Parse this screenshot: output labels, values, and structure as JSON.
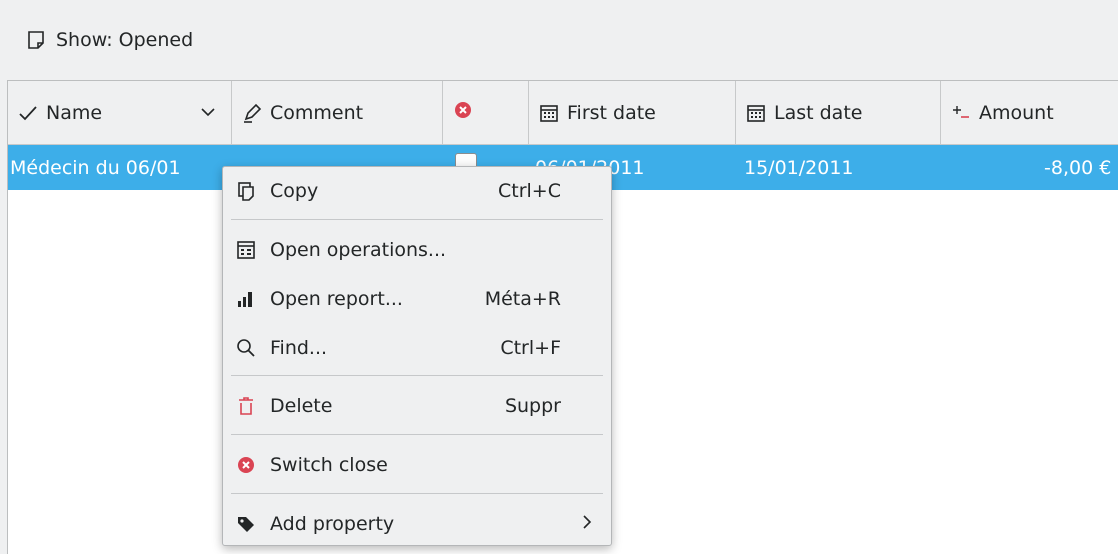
{
  "filter": {
    "label": "Show: Opened",
    "icon": "note-icon"
  },
  "columns": [
    {
      "label": "Name",
      "icon": "checkmark-icon"
    },
    {
      "label": "Comment",
      "icon": "pencil-icon"
    },
    {
      "label": "",
      "icon": "closed-status-icon"
    },
    {
      "label": "First date",
      "icon": "calendar-icon"
    },
    {
      "label": "Last date",
      "icon": "calendar-icon"
    },
    {
      "label": "Amount",
      "icon": "plus-minus-icon"
    }
  ],
  "rows": [
    {
      "name": "Médecin du 06/01",
      "first_date": "06/01/2011",
      "last_date": "15/01/2011",
      "amount": "-8,00 €"
    }
  ],
  "menu": {
    "copy": {
      "label": "Copy",
      "shortcut": "Ctrl+C"
    },
    "open_operations": {
      "label": "Open operations..."
    },
    "open_report": {
      "label": "Open report...",
      "shortcut": "Méta+R"
    },
    "find": {
      "label": "Find...",
      "shortcut": "Ctrl+F"
    },
    "delete": {
      "label": "Delete",
      "shortcut": "Suppr"
    },
    "switch_close": {
      "label": "Switch close"
    },
    "add_property": {
      "label": "Add property"
    }
  },
  "colors": {
    "selection": "#3daee9",
    "accent_red": "#da4453",
    "background": "#eff0f1"
  }
}
